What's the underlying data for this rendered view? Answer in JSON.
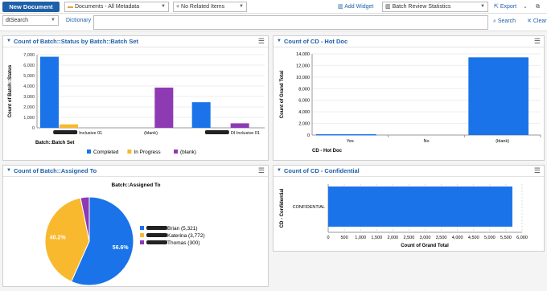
{
  "toolbar": {
    "new_document": "New Document",
    "documents_select": "Documents - All Metadata",
    "related_select": "+ No Related Items",
    "add_widget": "Add Widget",
    "dashboard_select": "Batch Review Statistics",
    "export": "Export"
  },
  "search": {
    "field": "dtSearch",
    "dictionary": "Dictionary",
    "search_label": "Search",
    "clear_label": "Clear"
  },
  "widgets": {
    "batch_status": {
      "title": "Count of Batch::Status by Batch::Batch Set"
    },
    "hot_doc": {
      "title": "Count of CD - Hot Doc"
    },
    "assigned_to": {
      "title": "Count of Batch::Assigned To"
    },
    "confidential": {
      "title": "Count of CD - Confidential"
    }
  },
  "colors": {
    "blue": "#1a73e8",
    "orange": "#f9b92e",
    "purple": "#8e3ab3",
    "accent": "#1f5fa8"
  },
  "chart_data": [
    {
      "type": "bar",
      "ylabel": "Count of Batch::Status",
      "xlabel": "Batch::Batch Set",
      "categories": [
        "Inclusive 01",
        "(blank)",
        "Inclusive 01"
      ],
      "category_prefixes": [
        "",
        "",
        "DI"
      ],
      "ylim": [
        0,
        7000
      ],
      "yticks": [
        "0",
        "1,000",
        "2,000",
        "3,000",
        "4,000",
        "5,000",
        "6,000",
        "7,000"
      ],
      "series": [
        {
          "name": "Completed",
          "values": [
            6800,
            0,
            2450
          ]
        },
        {
          "name": "In Progress",
          "values": [
            330,
            0,
            0
          ]
        },
        {
          "name": "(blank)",
          "values": [
            0,
            3850,
            430
          ]
        }
      ],
      "legend": "bottom"
    },
    {
      "type": "bar",
      "ylabel": "Count of Grand Total",
      "xlabel": "CD - Hot Doc",
      "categories": [
        "Yes",
        "No",
        "(blank)"
      ],
      "values": [
        150,
        0,
        13400
      ],
      "ylim": [
        0,
        14000
      ],
      "yticks": [
        "0",
        "2,000",
        "4,000",
        "6,000",
        "8,000",
        "10,000",
        "12,000",
        "14,000"
      ]
    },
    {
      "type": "pie",
      "title": "Batch::Assigned To",
      "slices": [
        {
          "name": "Brian (5,321)",
          "value": 5321,
          "label": "56.6%"
        },
        {
          "name": "Katerina (3,772)",
          "value": 3772,
          "label": "40.2%"
        },
        {
          "name": "Thomas (300)",
          "value": 300,
          "label": ""
        }
      ]
    },
    {
      "type": "bar",
      "orientation": "horizontal",
      "ylabel": "CD - Confidential",
      "xlabel": "Count of Grand Total",
      "categories": [
        "CONFIDENTIAL"
      ],
      "values": [
        5700
      ],
      "xlim": [
        0,
        6000
      ],
      "xticks": [
        "0",
        "500",
        "1,000",
        "1,500",
        "2,000",
        "2,500",
        "3,000",
        "3,500",
        "4,000",
        "4,500",
        "5,000",
        "5,500",
        "6,000"
      ]
    }
  ]
}
